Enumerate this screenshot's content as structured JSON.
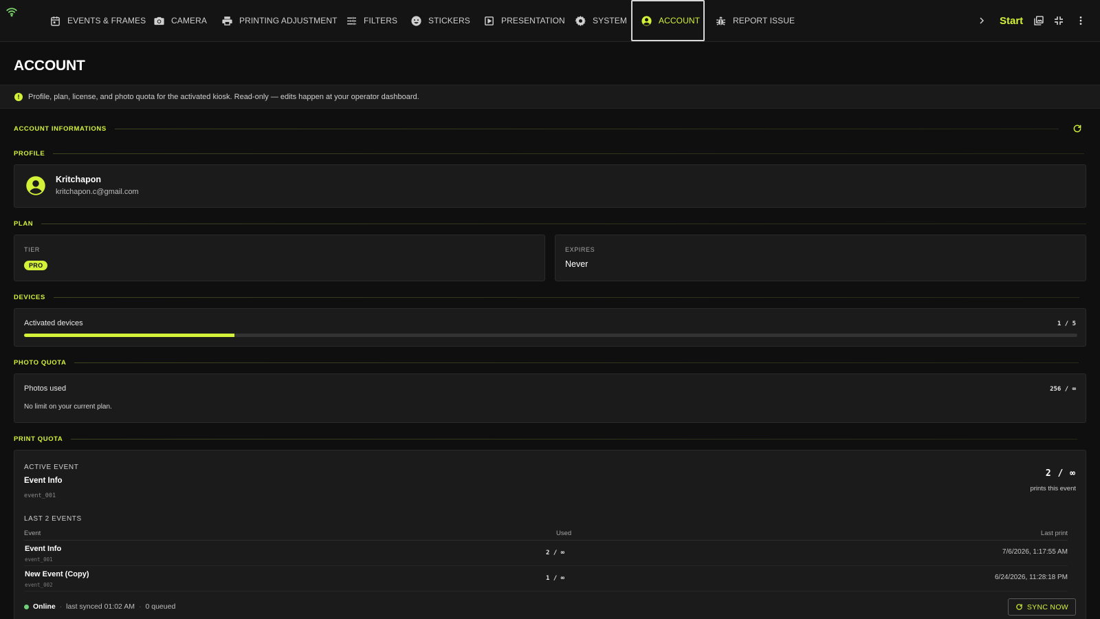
{
  "nav": {
    "tabs": [
      {
        "label": "EVENTS & FRAMES",
        "icon": "calendar-icon"
      },
      {
        "label": "CAMERA",
        "icon": "camera-icon"
      },
      {
        "label": "PRINTING ADJUSTMENT",
        "icon": "printer-icon"
      },
      {
        "label": "FILTERS",
        "icon": "sliders-icon"
      },
      {
        "label": "STICKERS",
        "icon": "smiley-icon"
      },
      {
        "label": "PRESENTATION",
        "icon": "play-icon"
      },
      {
        "label": "SYSTEM",
        "icon": "gear-icon"
      },
      {
        "label": "ACCOUNT",
        "icon": "account-icon"
      },
      {
        "label": "REPORT ISSUE",
        "icon": "bug-icon"
      }
    ],
    "active_tab": "ACCOUNT",
    "start_label": "Start"
  },
  "page": {
    "title": "ACCOUNT",
    "info": "Profile, plan, license, and photo quota for the activated kiosk. Read-only — edits happen at your operator dashboard."
  },
  "sections": {
    "account_info": "ACCOUNT INFORMATIONS",
    "profile": "PROFILE",
    "plan": "PLAN",
    "devices": "DEVICES",
    "photo_quota": "PHOTO QUOTA",
    "print_quota": "PRINT QUOTA"
  },
  "profile": {
    "name": "Kritchapon",
    "email": "kritchapon.c@gmail.com"
  },
  "plan": {
    "tier_label": "TIER",
    "tier_value": "PRO",
    "expires_label": "EXPIRES",
    "expires_value": "Never"
  },
  "devices": {
    "label": "Activated devices",
    "ratio": "1 / 5",
    "fraction": 0.2
  },
  "photo_quota": {
    "label": "Photos used",
    "ratio": "256 / ∞",
    "note": "No limit on your current plan."
  },
  "print_quota": {
    "active_label": "ACTIVE EVENT",
    "event_name": "Event Info",
    "event_id": "event_001",
    "big_ratio": "2 / ∞",
    "caption": "prints this event",
    "last_label": "LAST 2 EVENTS",
    "columns": [
      "Event",
      "Used",
      "Last print"
    ],
    "rows": [
      {
        "name": "Event Info",
        "id": "event_001",
        "used": "2 / ∞",
        "last": "7/6/2026, 1:17:55 AM"
      },
      {
        "name": "New Event (Copy)",
        "id": "event_002",
        "used": "1 / ∞",
        "last": "6/24/2026, 11:28:18 PM"
      }
    ],
    "status": {
      "online": "Online",
      "last_synced": "last synced 01:02 AM",
      "queued": "0 queued"
    },
    "sync_label": "SYNC NOW"
  },
  "colors": {
    "accent": "#d4f13a",
    "background": "#0f0f0f",
    "card": "#1b1b1b",
    "online": "#6ed17a"
  }
}
